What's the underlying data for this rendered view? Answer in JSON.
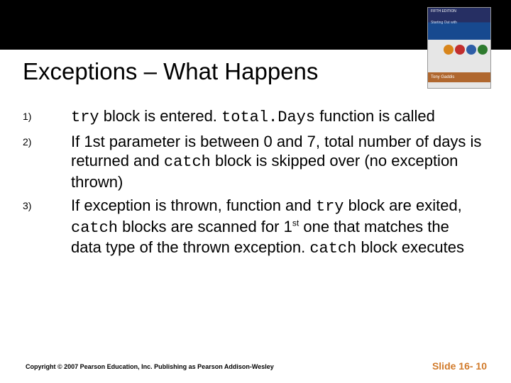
{
  "header": {
    "title": "Exceptions – What Happens"
  },
  "book": {
    "top_line": "FIFTH EDITION",
    "sub_line": "Starting Out with",
    "author": "Tony Gaddis"
  },
  "items": [
    {
      "num": "1)",
      "parts": [
        {
          "t": "try",
          "code": true
        },
        {
          "t": " block is entered.  "
        },
        {
          "t": "total.Days",
          "code": true
        },
        {
          "t": " function is called"
        }
      ]
    },
    {
      "num": "2)",
      "parts": [
        {
          "t": "If 1st parameter is between 0 and 7, total number of days is returned and "
        },
        {
          "t": "catch",
          "code": true
        },
        {
          "t": " block is skipped over (no exception thrown)"
        }
      ]
    },
    {
      "num": "3)",
      "parts": [
        {
          "t": "If exception is thrown, function and "
        },
        {
          "t": "try",
          "code": true
        },
        {
          "t": " block are exited, "
        },
        {
          "t": "catch",
          "code": true
        },
        {
          "t": " blocks are scanned for 1"
        },
        {
          "t": "st",
          "sup": true
        },
        {
          "t": " one that matches the data type of the thrown exception.  "
        },
        {
          "t": "catch",
          "code": true
        },
        {
          "t": " block executes"
        }
      ]
    }
  ],
  "footer": {
    "copyright": "Copyright © 2007 Pearson Education, Inc. Publishing as Pearson Addison-Wesley",
    "slide": "Slide 16- 10"
  }
}
